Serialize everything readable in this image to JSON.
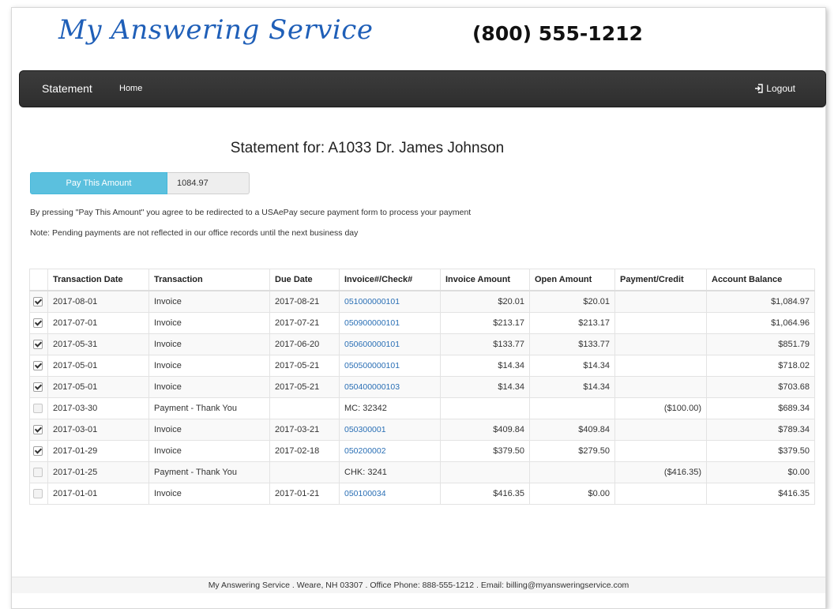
{
  "header": {
    "brand": "My Answering Service",
    "phone": "(800) 555-1212"
  },
  "nav": {
    "brand": "Statement",
    "home": "Home",
    "logout": "Logout"
  },
  "main": {
    "title": "Statement for: A1033 Dr. James Johnson",
    "pay_button": "Pay This Amount",
    "pay_amount": "1084.97",
    "notice1": "By pressing \"Pay This Amount\" you agree to be redirected to a USAePay secure payment form to process your payment",
    "notice2": "Note: Pending payments are not reflected in our office records until the next business day"
  },
  "table": {
    "headers": [
      "",
      "Transaction Date",
      "Transaction",
      "Due Date",
      "Invoice#/Check#",
      "Invoice Amount",
      "Open Amount",
      "Payment/Credit",
      "Account Balance"
    ],
    "rows": [
      {
        "checked": true,
        "disabled": false,
        "date": "2017-08-01",
        "transaction": "Invoice",
        "due": "2017-08-21",
        "ref": "051000000101",
        "ref_link": true,
        "invoice_amount": "$20.01",
        "open_amount": "$20.01",
        "payment": "",
        "balance": "$1,084.97"
      },
      {
        "checked": true,
        "disabled": false,
        "date": "2017-07-01",
        "transaction": "Invoice",
        "due": "2017-07-21",
        "ref": "050900000101",
        "ref_link": true,
        "invoice_amount": "$213.17",
        "open_amount": "$213.17",
        "payment": "",
        "balance": "$1,064.96"
      },
      {
        "checked": true,
        "disabled": false,
        "date": "2017-05-31",
        "transaction": "Invoice",
        "due": "2017-06-20",
        "ref": "050600000101",
        "ref_link": true,
        "invoice_amount": "$133.77",
        "open_amount": "$133.77",
        "payment": "",
        "balance": "$851.79"
      },
      {
        "checked": true,
        "disabled": false,
        "date": "2017-05-01",
        "transaction": "Invoice",
        "due": "2017-05-21",
        "ref": "050500000101",
        "ref_link": true,
        "invoice_amount": "$14.34",
        "open_amount": "$14.34",
        "payment": "",
        "balance": "$718.02"
      },
      {
        "checked": true,
        "disabled": false,
        "date": "2017-05-01",
        "transaction": "Invoice",
        "due": "2017-05-21",
        "ref": "050400000103",
        "ref_link": true,
        "invoice_amount": "$14.34",
        "open_amount": "$14.34",
        "payment": "",
        "balance": "$703.68"
      },
      {
        "checked": false,
        "disabled": true,
        "date": "2017-03-30",
        "transaction": "Payment - Thank You",
        "due": "",
        "ref": "MC: 32342",
        "ref_link": false,
        "invoice_amount": "",
        "open_amount": "",
        "payment": "($100.00)",
        "balance": "$689.34"
      },
      {
        "checked": true,
        "disabled": false,
        "date": "2017-03-01",
        "transaction": "Invoice",
        "due": "2017-03-21",
        "ref": "050300001",
        "ref_link": true,
        "invoice_amount": "$409.84",
        "open_amount": "$409.84",
        "payment": "",
        "balance": "$789.34"
      },
      {
        "checked": true,
        "disabled": false,
        "date": "2017-01-29",
        "transaction": "Invoice",
        "due": "2017-02-18",
        "ref": "050200002",
        "ref_link": true,
        "invoice_amount": "$379.50",
        "open_amount": "$279.50",
        "payment": "",
        "balance": "$379.50"
      },
      {
        "checked": false,
        "disabled": true,
        "date": "2017-01-25",
        "transaction": "Payment - Thank You",
        "due": "",
        "ref": "CHK: 3241",
        "ref_link": false,
        "invoice_amount": "",
        "open_amount": "",
        "payment": "($416.35)",
        "balance": "$0.00"
      },
      {
        "checked": false,
        "disabled": true,
        "date": "2017-01-01",
        "transaction": "Invoice",
        "due": "2017-01-21",
        "ref": "050100034",
        "ref_link": true,
        "invoice_amount": "$416.35",
        "open_amount": "$0.00",
        "payment": "",
        "balance": "$416.35"
      }
    ]
  },
  "footer": {
    "text": "My Answering Service . Weare, NH 03307 . Office Phone: 888-555-1212 . Email: billing@myansweringservice.com"
  },
  "colors": {
    "brand_blue": "#1f5fb8",
    "navbar": "#333333",
    "pay_button": "#5bc0de",
    "link": "#2a6fb5"
  }
}
